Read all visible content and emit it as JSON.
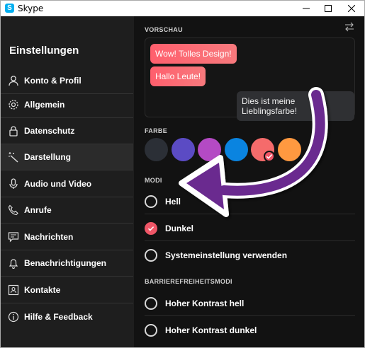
{
  "window": {
    "title": "Skype",
    "app_icon_letter": "S"
  },
  "sidebar": {
    "heading": "Einstellungen",
    "items": [
      {
        "label": "Konto & Profil",
        "icon": "person-icon",
        "active": false
      },
      {
        "label": "Allgemein",
        "icon": "gear-icon",
        "active": false
      },
      {
        "label": "Datenschutz",
        "icon": "lock-icon",
        "active": false
      },
      {
        "label": "Darstellung",
        "icon": "magic-wand-icon",
        "active": true
      },
      {
        "label": "Audio und Video",
        "icon": "microphone-icon",
        "active": false
      },
      {
        "label": "Anrufe",
        "icon": "phone-icon",
        "active": false
      },
      {
        "label": "Nachrichten",
        "icon": "message-icon",
        "active": false
      },
      {
        "label": "Benachrichtigungen",
        "icon": "bell-icon",
        "active": false
      },
      {
        "label": "Kontakte",
        "icon": "contact-card-icon",
        "active": false
      },
      {
        "label": "Hilfe & Feedback",
        "icon": "info-icon",
        "active": false
      }
    ]
  },
  "main": {
    "preview_label": "VORSCHAU",
    "preview_messages": [
      {
        "text": "Wow! Tolles Design!",
        "side": "incoming"
      },
      {
        "text": "Hallo Leute!",
        "side": "incoming"
      },
      {
        "text": "Dies ist meine Lieblingsfarbe!",
        "side": "outgoing"
      }
    ],
    "color_label": "FARBE",
    "colors": [
      {
        "name": "dark",
        "hex": "#2b2f36",
        "selected": false
      },
      {
        "name": "indigo",
        "hex": "#5b4bc4",
        "selected": false
      },
      {
        "name": "violet",
        "hex": "#b44ac4",
        "selected": false
      },
      {
        "name": "blue",
        "hex": "#0a84e0",
        "selected": false
      },
      {
        "name": "coral",
        "hex": "#f56b6b",
        "selected": true
      },
      {
        "name": "orange",
        "hex": "#ff9940",
        "selected": false
      }
    ],
    "modes_label": "MODI",
    "modes": [
      {
        "label": "Hell",
        "checked": false
      },
      {
        "label": "Dunkel",
        "checked": true
      },
      {
        "label": "Systemeinstellung verwenden",
        "checked": false
      }
    ],
    "accessibility_label": "BARRIEREFREIHEITSMODI",
    "accessibility_modes": [
      {
        "label": "Hoher Kontrast hell",
        "checked": false
      },
      {
        "label": "Hoher Kontrast dunkel",
        "checked": false
      }
    ]
  },
  "accent_color": "#ef5667",
  "annotation_arrow_color": "#6a2a8f"
}
